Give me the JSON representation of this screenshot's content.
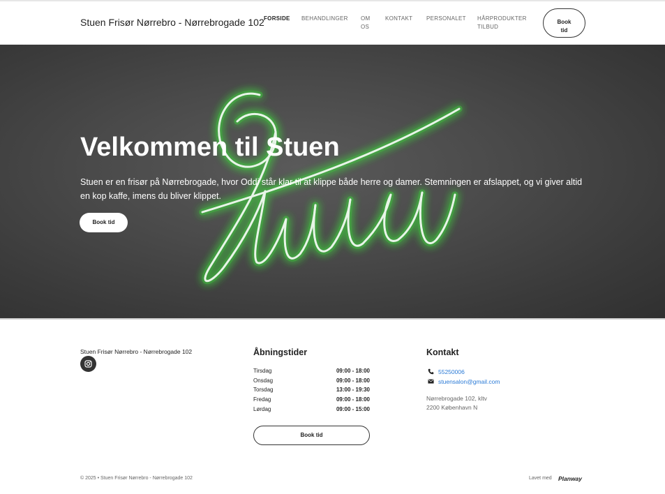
{
  "header": {
    "brand": "Stuen Frisør Nørrebro - Nørrebrogade 102",
    "nav": [
      {
        "label": "FORSIDE",
        "active": true
      },
      {
        "label": "BEHANDLINGER"
      },
      {
        "label_line1": "OM",
        "label_line2": "OS"
      },
      {
        "label": "KONTAKT"
      },
      {
        "label": "PERSONALET"
      },
      {
        "label_line1": "HÅRPRODUKTER",
        "label_line2": "TILBUD"
      }
    ],
    "book_line1": "Book",
    "book_line2": "tid"
  },
  "hero": {
    "title": "Velkommen til Stuen",
    "text": "Stuen er en frisør på Nørrebrogade, hvor Oddi står klar til at klippe både herre og damer. Stemningen er afslappet, og vi giver altid en kop kaffe, imens du bliver klippet.",
    "button": "Book tid",
    "neon_color": "#3ddc3a",
    "background_color": "#4a4a4a"
  },
  "footer": {
    "brand": "Stuen Frisør Nørrebro - Nørrebrogade 102",
    "social_icon": "instagram-icon",
    "hours_title": "Åbningstider",
    "hours": [
      {
        "day": "Tirsdag",
        "time": "09:00 - 18:00"
      },
      {
        "day": "Onsdag",
        "time": "09:00 - 18:00"
      },
      {
        "day": "Torsdag",
        "time": "13:00 - 19:30"
      },
      {
        "day": "Fredag",
        "time": "09:00 - 18:00"
      },
      {
        "day": "Lørdag",
        "time": "09:00 - 15:00"
      }
    ],
    "book_button": "Book tid",
    "contact_title": "Kontakt",
    "phone": "55250006",
    "email": "stuensalon@gmail.com",
    "address_line1": "Nørrebrogade 102, kltv",
    "address_line2": "2200 København N",
    "copyright": "© 2025 • Stuen Frisør Nørrebro - Nørrebrogade 102",
    "made_with": "Lavet med",
    "made_with_brand": "Planway",
    "link_color": "#2a7ad6"
  }
}
